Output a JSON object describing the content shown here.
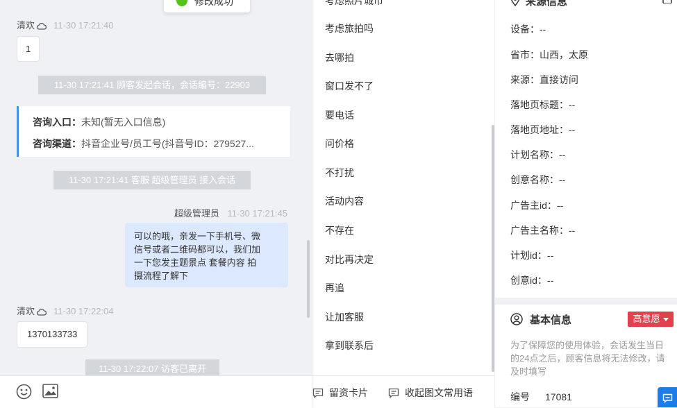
{
  "toast": {
    "text": "修改成功"
  },
  "chat": {
    "messages": [
      {
        "sender": "清欢",
        "time": "11-30 17:21:40",
        "text": "1"
      },
      {
        "sender": "超级管理员",
        "time": "11-30 17:21:45",
        "lines": [
          "可以的哦，亲发一下手机号、微",
          "信号或者二维码都可以，我们加",
          "一下您发主题景点 套餐内容 拍",
          "摄流程了解下"
        ]
      },
      {
        "sender": "清欢",
        "time": "11-30 17:22:04",
        "text": "1370133733"
      }
    ],
    "system": [
      "11-30 17:21:41 顾客发起会话，会话编号：22903",
      "11-30 17:21:41 客服 超级管理员 接入会话",
      "11-30 17:22:07 访客已离开"
    ],
    "card": {
      "entry_label": "咨询入口：",
      "entry_value": "未知(暂无入口信息)",
      "channel_label": "咨询渠道：",
      "channel_value": "抖音企业号/员工号(抖音号ID：279527..."
    },
    "toolbar": {
      "emoji_icon": "smile-icon",
      "image_icon": "image-icon"
    }
  },
  "quick_replies": {
    "items": [
      "考虑照片城市",
      "考虑旅拍吗",
      "去哪拍",
      "窗口发不了",
      "要电话",
      "问价格",
      "不打扰",
      "活动内容",
      "不存在",
      "对比再决定",
      "再追",
      "让加客服",
      "拿到联系后"
    ],
    "toolbar": {
      "card_label": "留资卡片",
      "collect_label": "收起图文常用语"
    }
  },
  "info": {
    "source_title": "来源信息",
    "fields": [
      {
        "label": "设备：",
        "value": "--"
      },
      {
        "label": "省市：",
        "value": "山西，太原"
      },
      {
        "label": "来源：",
        "value": "直接访问"
      },
      {
        "label": "落地页标题：",
        "value": "--"
      },
      {
        "label": "落地页地址：",
        "value": "--"
      },
      {
        "label": "计划名称：",
        "value": "--"
      },
      {
        "label": "创意名称：",
        "value": "--"
      },
      {
        "label": "广告主id：",
        "value": "--"
      },
      {
        "label": "广告主名称：",
        "value": "--"
      },
      {
        "label": "计划id：",
        "value": "--"
      },
      {
        "label": "创意id：",
        "value": "--"
      }
    ],
    "basic_title": "基本信息",
    "intent_badge": "高意愿",
    "notice": "为了保障您的使用体验，会话发生当日的24点之后，顾客信息将无法修改，请及时填写",
    "id_label": "编号",
    "id_value": "17081"
  },
  "colors": {
    "accent": "#4a90e2",
    "intent": "#e0414d",
    "bubble_right": "#dbe8fd",
    "success": "#52c41a"
  }
}
